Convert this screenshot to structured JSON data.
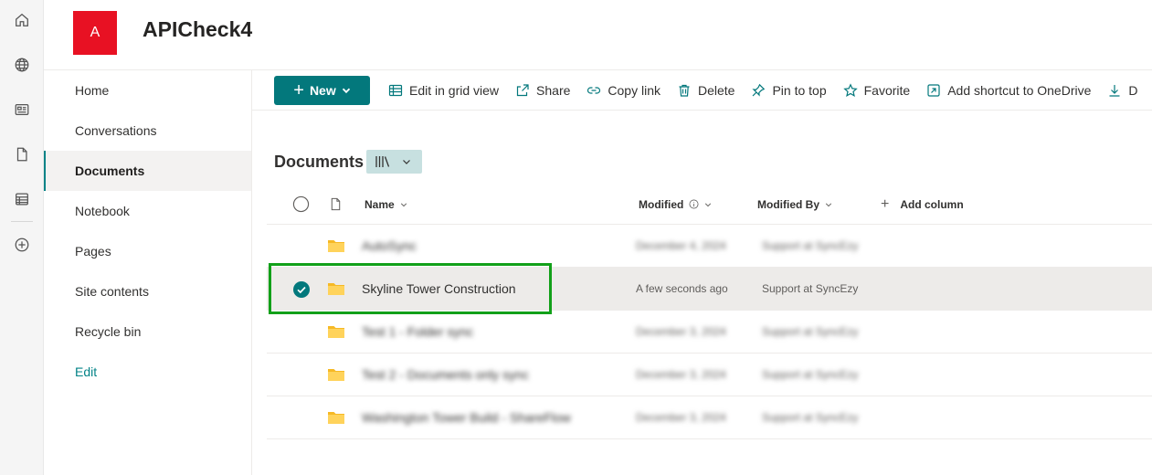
{
  "site": {
    "logo_letter": "A",
    "title": "APICheck4",
    "brand_color": "#03787c",
    "logo_color": "#e81123"
  },
  "rail": {
    "icons": [
      "home-icon",
      "globe-icon",
      "news-icon",
      "file-icon",
      "list-icon",
      "add-icon"
    ]
  },
  "leftnav": {
    "items": [
      {
        "label": "Home"
      },
      {
        "label": "Conversations"
      },
      {
        "label": "Documents"
      },
      {
        "label": "Notebook"
      },
      {
        "label": "Pages"
      },
      {
        "label": "Site contents"
      },
      {
        "label": "Recycle bin"
      },
      {
        "label": "Edit"
      }
    ],
    "active": "Documents"
  },
  "cmdbar": {
    "new_label": "New",
    "edit_grid_label": "Edit in grid view",
    "share_label": "Share",
    "copy_link_label": "Copy link",
    "delete_label": "Delete",
    "pin_label": "Pin to top",
    "favorite_label": "Favorite",
    "shortcut_label": "Add shortcut to OneDrive",
    "download_label": "D"
  },
  "library": {
    "title": "Documents",
    "columns": {
      "name": "Name",
      "modified": "Modified",
      "modified_by": "Modified By",
      "add_column": "Add column"
    },
    "rows": [
      {
        "name": "AutoSync",
        "modified": "December 4, 2024",
        "modified_by": "Support at SyncEzy",
        "blurred": true,
        "selected": false
      },
      {
        "name": "Skyline Tower Construction",
        "modified": "A few seconds ago",
        "modified_by": "Support at SyncEzy",
        "blurred": false,
        "selected": true
      },
      {
        "name": "Test 1 - Folder sync",
        "modified": "December 3, 2024",
        "modified_by": "Support at SyncEzy",
        "blurred": true,
        "selected": false
      },
      {
        "name": "Test 2 - Documents only sync",
        "modified": "December 3, 2024",
        "modified_by": "Support at SyncEzy",
        "blurred": true,
        "selected": false
      },
      {
        "name": "Washington Tower Build - ShareFlow",
        "modified": "December 3, 2024",
        "modified_by": "Support at SyncEzy",
        "blurred": true,
        "selected": false
      }
    ]
  },
  "highlight_color": "#12a019"
}
